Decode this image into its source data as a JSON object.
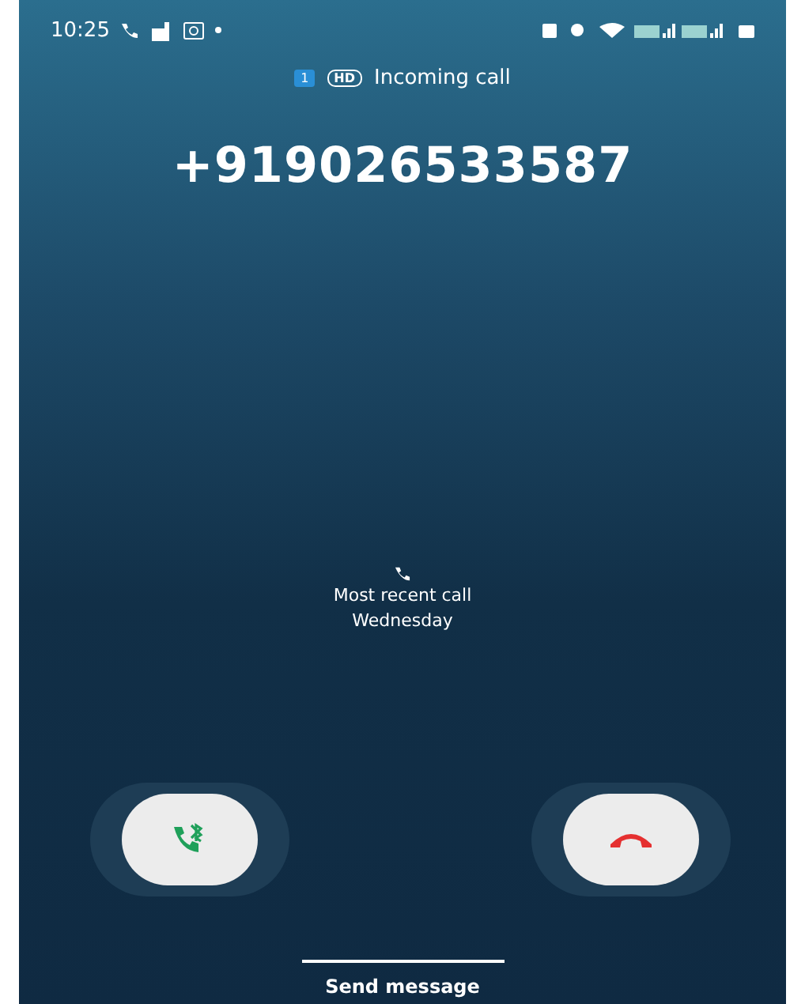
{
  "status_bar": {
    "time": "10:25"
  },
  "call_header": {
    "sim": "1",
    "hd": "HD",
    "label": "Incoming call"
  },
  "caller": {
    "number": "+919026533587"
  },
  "recent_call": {
    "label": "Most recent call",
    "day": "Wednesday"
  },
  "actions": [
    {
      "kind": "answer"
    },
    {
      "kind": "decline"
    }
  ],
  "send_message": "Send message"
}
